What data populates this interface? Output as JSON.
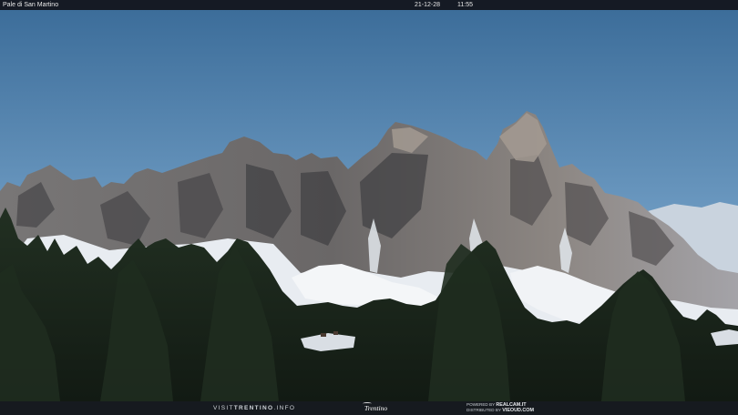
{
  "overlay": {
    "location": "Pale di San Martino",
    "date": "21-12-28",
    "time": "11:55"
  },
  "footer": {
    "site_prefix": "VISIT",
    "site_main": "TRENTINO",
    "site_suffix": ".INFO",
    "brand": "Trentino",
    "powered_label": "POWERED BY",
    "powered_name": "REALCAM.IT",
    "distributed_label": "DISTRIBUTED BY",
    "distributed_name": "VIEOUD.COM"
  },
  "colors": {
    "sky_top": "#3d6f9c",
    "sky_bottom": "#a9c6dd",
    "rock": "#6e6b6a",
    "rock_shadow": "#3c3b3f",
    "snow": "#eef1f4",
    "forest": "#1a2419",
    "bar": "#12141a"
  }
}
